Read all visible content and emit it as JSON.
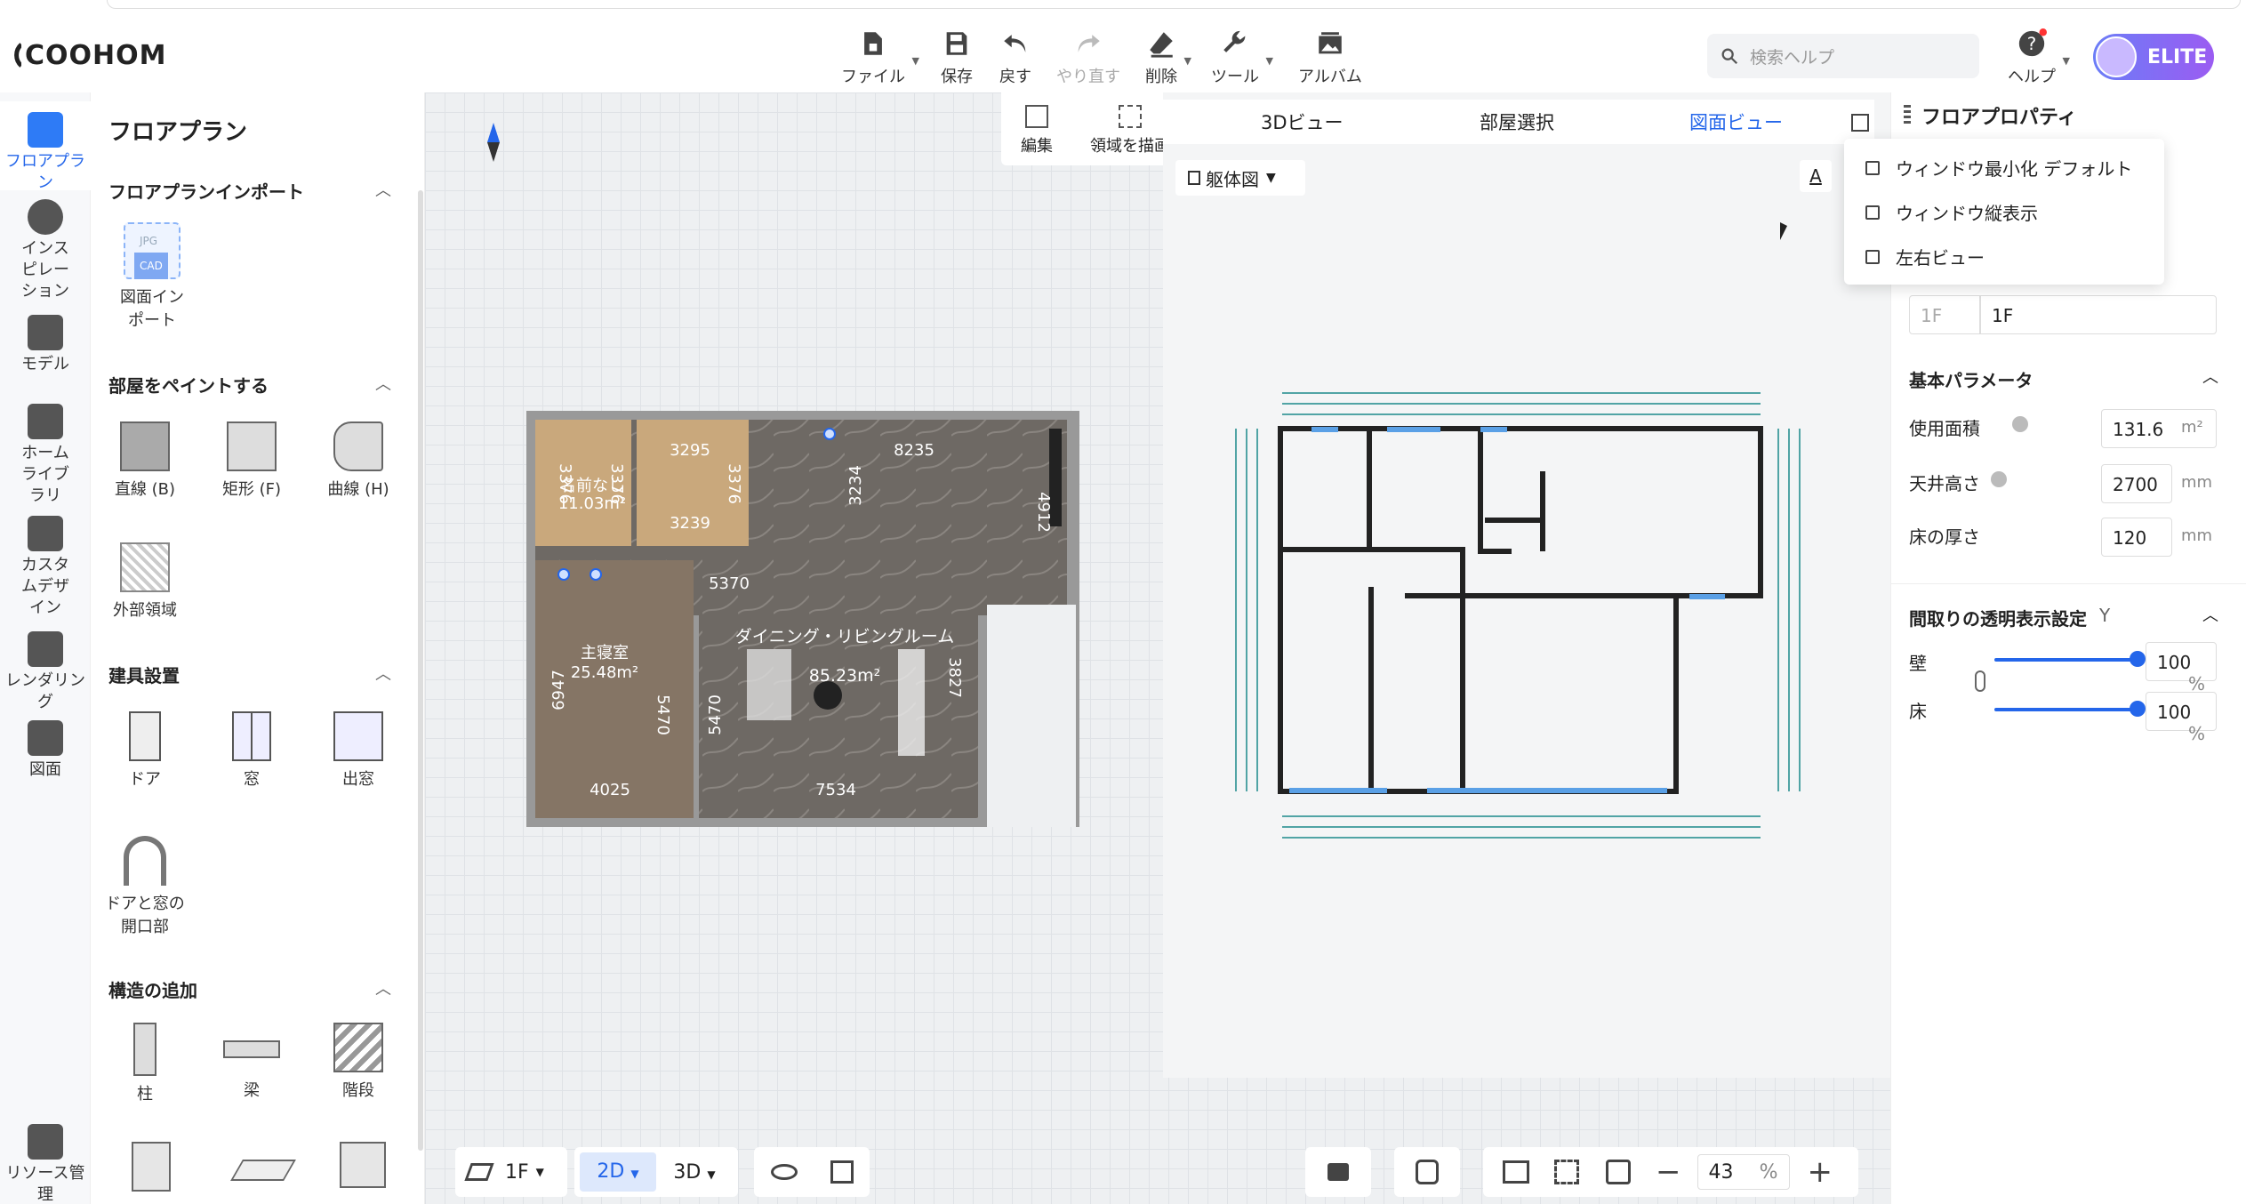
{
  "app": {
    "logo": "COOHOM"
  },
  "toolbar": {
    "file": "ファイル",
    "save": "保存",
    "undo": "戻す",
    "redo": "やり直す",
    "delete": "削除",
    "tools": "ツール",
    "album": "アルバム",
    "help": "ヘルプ"
  },
  "search": {
    "placeholder": "検索ヘルプ"
  },
  "user": {
    "badge": "ELITE"
  },
  "rail": {
    "items": [
      "フロアプラン",
      "インスピレーション",
      "モデル",
      "ホームライブラリ",
      "カスタムデザイン",
      "レンダリング",
      "図面",
      "リソース管理"
    ]
  },
  "left_panel": {
    "title": "フロアプラン",
    "sections": {
      "import": "フロアプランインポート",
      "paint": "部屋をペイントする",
      "fixtures": "建具設置",
      "structure": "構造の追加"
    },
    "import_item": "図面インポート",
    "import_icon_text": [
      "JPG",
      "CAD"
    ],
    "paint_items": [
      "直線 (B)",
      "矩形 (F)",
      "曲線 (H)",
      "外部領域"
    ],
    "fixture_items": [
      "ドア",
      "窓",
      "出窓",
      "ドアと窓の開口部"
    ],
    "structure_items": [
      "柱",
      "梁",
      "階段"
    ]
  },
  "canvas_tools": {
    "edit": "編集",
    "draw_area": "領域を描画"
  },
  "view_tabs": {
    "tab_3d": "3Dビュー",
    "room_select": "部屋選択",
    "plan_view": "図面ビュー"
  },
  "view_dropdown": "躯体図",
  "floorplan": {
    "rooms": [
      {
        "name": "名前なし",
        "area": "11.03m²"
      },
      {
        "name": "主寝室",
        "area": "25.48m²"
      },
      {
        "name": "ダイニング・リビングルーム",
        "area": "85.23m²"
      }
    ],
    "dims": [
      "3376",
      "3376",
      "3295",
      "3239",
      "3376",
      "8235",
      "3234",
      "4912",
      "5370",
      "6947",
      "5470",
      "5470",
      "3827",
      "4025",
      "7534"
    ]
  },
  "window_menu": {
    "items": [
      "ウィンドウ最小化 デフォルト",
      "ウィンドウ縦表示",
      "左右ビュー"
    ]
  },
  "right_panel": {
    "title": "フロアプロパティ",
    "floor_select": "1F",
    "floor_name": "1F",
    "basic_title": "基本パラメータ",
    "area_label": "使用面積",
    "area_value": "131.6",
    "area_unit": "m²",
    "ceiling_label": "天井高さ",
    "ceiling_value": "2700",
    "ceiling_unit": "mm",
    "floor_thickness_label": "床の厚さ",
    "floor_thickness_value": "120",
    "floor_thickness_unit": "mm",
    "transparency_title": "間取りの透明表示設定",
    "transparency_key": "Y",
    "wall_label": "壁",
    "wall_value": "100",
    "floor_label": "床",
    "floor_value": "100",
    "percent": "%"
  },
  "bottom_bar": {
    "floor": "1F",
    "mode_2d": "2D",
    "mode_3d": "3D",
    "zoom": "43",
    "zoom_unit": "%"
  },
  "colors": {
    "accent": "#2466ea",
    "blueprint": "#1b8a8a"
  }
}
